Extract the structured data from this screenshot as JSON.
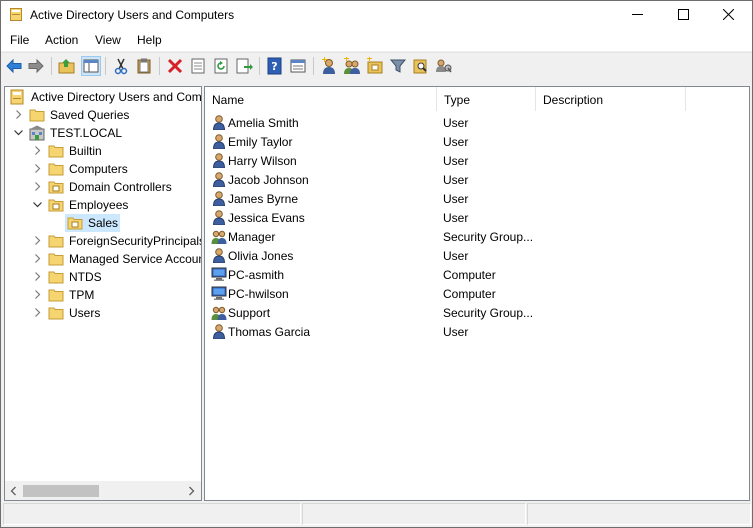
{
  "window": {
    "title": "Active Directory Users and Computers",
    "icons": {
      "app": "folder-tree-icon",
      "minimize": "minimize-icon",
      "maximize": "maximize-icon",
      "close": "close-icon"
    }
  },
  "menu": [
    "File",
    "Action",
    "View",
    "Help"
  ],
  "toolbar": [
    "back-arrow-icon",
    "forward-arrow-icon",
    "up-folder-icon",
    "show-hide-console-tree-icon",
    "cut-icon",
    "copy-icon",
    "delete-icon",
    "properties-icon",
    "refresh-icon",
    "export-list-icon",
    "help-icon",
    "console-details-icon",
    "new-user-icon",
    "new-group-icon",
    "new-ou-icon",
    "filter-icon",
    "find-icon",
    "delegate-control-icon"
  ],
  "tree": {
    "root": "Active Directory Users and Computers",
    "items": [
      {
        "label": "Saved Queries",
        "expanded": false
      },
      {
        "label": "TEST.LOCAL",
        "expanded": true
      },
      {
        "label": "Builtin",
        "expanded": false
      },
      {
        "label": "Computers",
        "expanded": false
      },
      {
        "label": "Domain Controllers",
        "expanded": false
      },
      {
        "label": "Employees",
        "expanded": true
      },
      {
        "label": "Sales",
        "selected": true
      },
      {
        "label": "ForeignSecurityPrincipals",
        "expanded": false
      },
      {
        "label": "Managed Service Accounts",
        "expanded": false
      },
      {
        "label": "NTDS",
        "expanded": false
      },
      {
        "label": "TPM",
        "expanded": false
      },
      {
        "label": "Users",
        "expanded": false
      }
    ]
  },
  "list": {
    "columns": [
      "Name",
      "Type",
      "Description"
    ],
    "rows": [
      {
        "name": "Amelia Smith",
        "type": "User",
        "icon": "user-icon"
      },
      {
        "name": "Emily Taylor",
        "type": "User",
        "icon": "user-icon"
      },
      {
        "name": "Harry Wilson",
        "type": "User",
        "icon": "user-icon"
      },
      {
        "name": "Jacob Johnson",
        "type": "User",
        "icon": "user-icon"
      },
      {
        "name": "James Byrne",
        "type": "User",
        "icon": "user-icon"
      },
      {
        "name": "Jessica Evans",
        "type": "User",
        "icon": "user-icon"
      },
      {
        "name": "Manager",
        "type": "Security Group...",
        "icon": "group-icon"
      },
      {
        "name": "Olivia Jones",
        "type": "User",
        "icon": "user-icon"
      },
      {
        "name": "PC-asmith",
        "type": "Computer",
        "icon": "computer-icon"
      },
      {
        "name": "PC-hwilson",
        "type": "Computer",
        "icon": "computer-icon"
      },
      {
        "name": "Support",
        "type": "Security Group...",
        "icon": "group-icon"
      },
      {
        "name": "Thomas Garcia",
        "type": "User",
        "icon": "user-icon"
      }
    ]
  }
}
